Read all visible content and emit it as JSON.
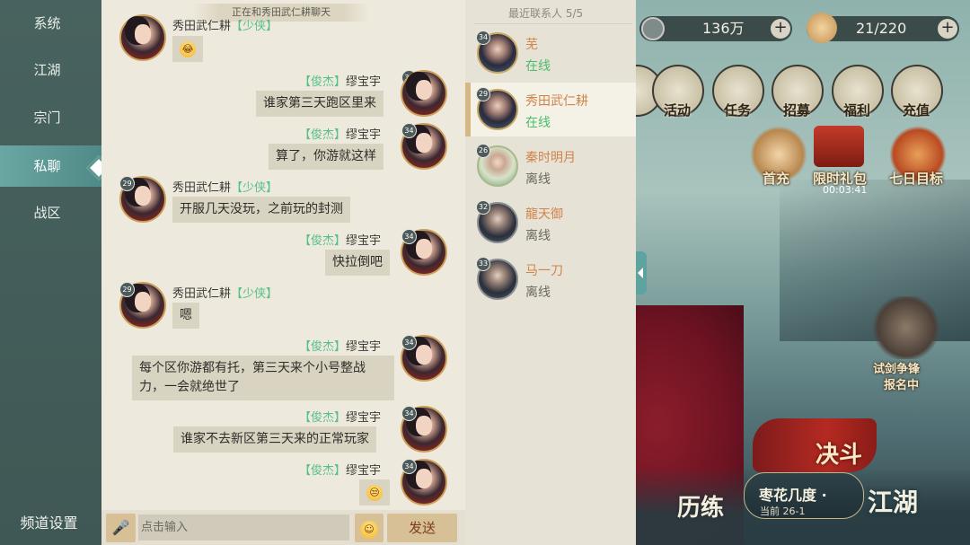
{
  "sidebar": {
    "items": [
      {
        "label": "系统"
      },
      {
        "label": "江湖"
      },
      {
        "label": "宗门"
      },
      {
        "label": "私聊"
      },
      {
        "label": "战区"
      }
    ],
    "channel_settings": "频道设置"
  },
  "chat": {
    "banner": "正在和秀田武仁耕聊天",
    "messages": [
      {
        "side": "left",
        "name": "秀田武仁耕",
        "tag": "【少侠】",
        "level": "29",
        "text": "😂"
      },
      {
        "side": "right",
        "name": "缪宝宇",
        "tag": "【俊杰】",
        "level": "34",
        "text": "谁家第三天跑区里来"
      },
      {
        "side": "right",
        "name": "缪宝宇",
        "tag": "【俊杰】",
        "level": "34",
        "text": "算了，你游就这样"
      },
      {
        "side": "left",
        "name": "秀田武仁耕",
        "tag": "【少侠】",
        "level": "29",
        "text": "开服几天没玩，之前玩的封测"
      },
      {
        "side": "right",
        "name": "缪宝宇",
        "tag": "【俊杰】",
        "level": "34",
        "text": "快拉倒吧"
      },
      {
        "side": "left",
        "name": "秀田武仁耕",
        "tag": "【少侠】",
        "level": "29",
        "text": "嗯"
      },
      {
        "side": "right",
        "name": "缪宝宇",
        "tag": "【俊杰】",
        "level": "34",
        "text": "每个区你游都有托，第三天来个小号整战力，一会就绝世了"
      },
      {
        "side": "right",
        "name": "缪宝宇",
        "tag": "【俊杰】",
        "level": "34",
        "text": "谁家不去新区第三天来的正常玩家"
      },
      {
        "side": "right",
        "name": "缪宝宇",
        "tag": "【俊杰】",
        "level": "34",
        "text": "😒"
      }
    ],
    "input_placeholder": "点击输入",
    "send_label": "发送"
  },
  "contacts": {
    "title": "最近联系人 5/5",
    "list": [
      {
        "name": "芜",
        "status": "在线",
        "level": "34"
      },
      {
        "name": "秀田武仁耕",
        "status": "在线",
        "level": "29"
      },
      {
        "name": "秦时明月",
        "status": "离线",
        "level": "26"
      },
      {
        "name": "龍天御",
        "status": "离线",
        "level": "32"
      },
      {
        "name": "马一刀",
        "status": "离线",
        "level": "33"
      }
    ]
  },
  "game": {
    "coins": "136万",
    "stamina": "21/220",
    "buttons": [
      "活动",
      "任务",
      "招募",
      "福利",
      "充值"
    ],
    "events": [
      "首充",
      "限时礼包",
      "七日目标"
    ],
    "timer": "00:03:41",
    "tournament": [
      "试剑争锋",
      "报名中"
    ],
    "duel": "决斗",
    "training": "历练",
    "stage_name": "枣花几度 ·",
    "stage_sub": "当前 26-1",
    "jianghu": "江湖"
  },
  "colors": {
    "sidebar_bg": "#48625f",
    "sidebar_active": "#6aa6a2",
    "chat_bg": "#ede9dc",
    "bubble_bg": "#d9d3c1",
    "tag_green": "#56c08a",
    "contact_name": "#d0844a",
    "online_green": "#4bbd6b",
    "button_gold": "#d7c096"
  }
}
